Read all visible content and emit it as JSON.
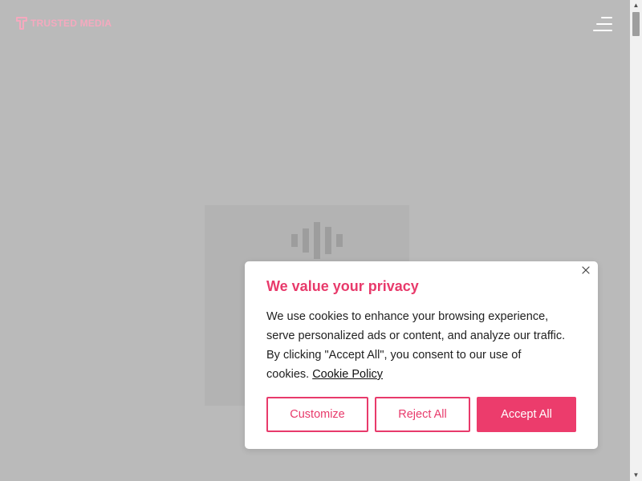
{
  "header": {
    "logo_text": "TRUSTED MEDIA",
    "logo_icon": "t-logo-icon",
    "menu_icon": "hamburger-menu-icon"
  },
  "media": {
    "icon": "equalizer-bars-icon"
  },
  "cookie_banner": {
    "title": "We value your privacy",
    "body_text": "We use cookies to enhance your browsing experience, serve personalized ads or content, and analyze our traffic. By clicking \"Accept All\", you consent to our use of cookies.",
    "policy_link": "Cookie Policy",
    "buttons": {
      "customize": "Customize",
      "reject": "Reject All",
      "accept": "Accept All"
    },
    "close_icon": "close-icon"
  },
  "colors": {
    "accent": "#e83a6b",
    "logo": "#f5a9be",
    "overlay": "#bababa"
  }
}
